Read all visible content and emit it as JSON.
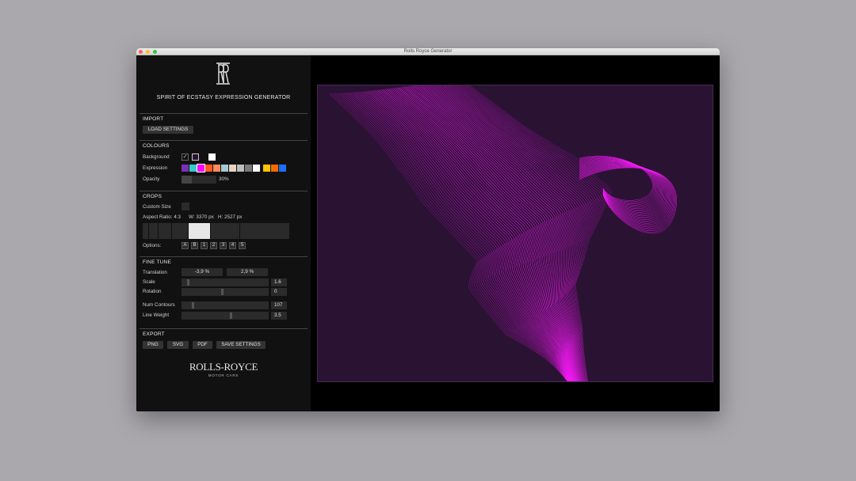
{
  "window": {
    "title": "Rolls Royce Generator"
  },
  "header": {
    "title": "SPIRIT OF ECSTASY EXPRESSION GENERATOR"
  },
  "import": {
    "title": "IMPORT",
    "load_label": "LOAD SETTINGS"
  },
  "colours": {
    "title": "COLOURS",
    "background_label": "Background",
    "expression_label": "Expression",
    "opacity_label": "Opacity",
    "opacity_value": "30%",
    "opacity_level": 0.3,
    "background_swatches": [
      "#111111",
      "#2a1233",
      "#ffffff"
    ],
    "expression_swatches": [
      "#7b2fb5",
      "#33cccc",
      "#ff00ff",
      "#ff5a1f",
      "#ff8c5a",
      "#a7c7d9",
      "#e8d3c0",
      "#bdbdbd",
      "#7a7a7a",
      "#ffffff",
      "#ffc400",
      "#ff6a00",
      "#1e6fff"
    ]
  },
  "crops": {
    "title": "CROPS",
    "custom_size_label": "Custom Size",
    "aspect_label": "Aspect Ratio: 4:3",
    "width_label": "W: 3370 px",
    "height_label": "H: 2527 px",
    "options_label": "Options:",
    "options": [
      "A",
      "B",
      "1",
      "2",
      "3",
      "4",
      "5"
    ]
  },
  "fine_tune": {
    "title": "FINE TUNE",
    "translation_label": "Translation",
    "translation_x": "-3,9 %",
    "translation_y": "2,9 %",
    "scale_label": "Scale",
    "scale_value": "1.6",
    "rotation_label": "Rotation",
    "rotation_value": "0",
    "num_contours_label": "Num Contours",
    "num_contours_value": "107",
    "line_weight_label": "Line Weight",
    "line_weight_value": "3.5"
  },
  "export": {
    "title": "EXPORT",
    "png_label": "PNG",
    "svg_label": "SVG",
    "pdf_label": "PDF",
    "save_label": "SAVE SETTINGS"
  },
  "branding": {
    "logo_text": "ROLLS-ROYCE",
    "sub_text": "MOTOR CARS"
  },
  "colors": {
    "expression": "#ff1aff",
    "canvas_background": "#2a1233"
  }
}
